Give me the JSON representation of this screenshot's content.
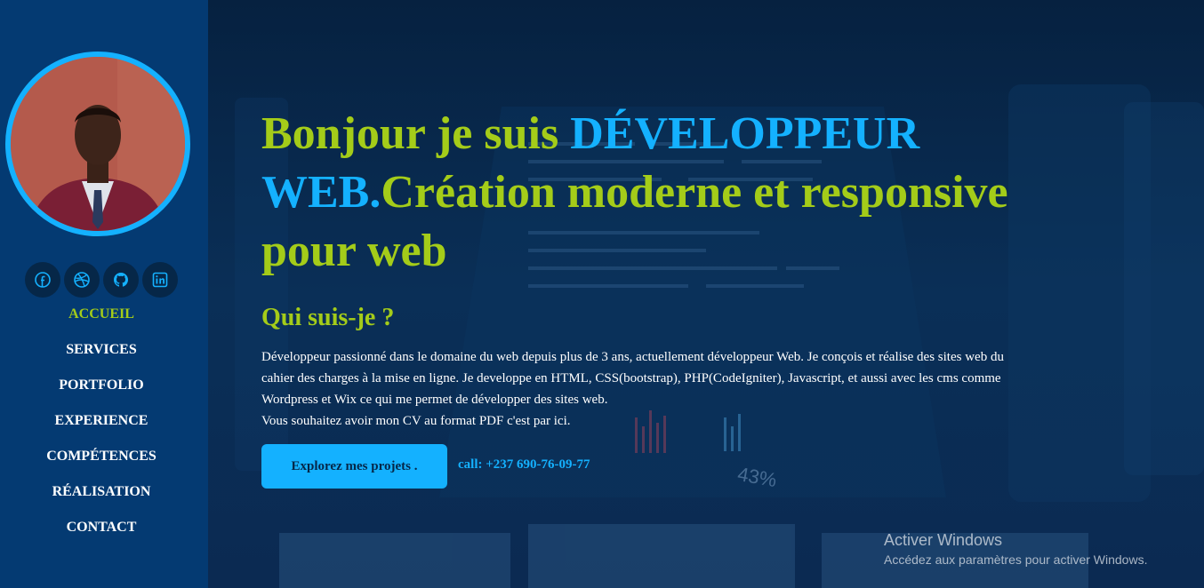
{
  "sidebar": {
    "socials": [
      {
        "icon": "facebook-icon"
      },
      {
        "icon": "dribbble-icon"
      },
      {
        "icon": "github-icon"
      },
      {
        "icon": "linkedin-icon"
      }
    ],
    "nav": [
      {
        "label": "ACCUEIL",
        "active": true
      },
      {
        "label": "SERVICES",
        "active": false
      },
      {
        "label": "PORTFOLIO",
        "active": false
      },
      {
        "label": "EXPERIENCE",
        "active": false
      },
      {
        "label": "COMPÉTENCES",
        "active": false
      },
      {
        "label": "RÉALISATION",
        "active": false
      },
      {
        "label": "CONTACT",
        "active": false
      }
    ]
  },
  "hero": {
    "title_prefix": "Bonjour je suis ",
    "title_highlight": "DÉVELOPPEUR WEB.",
    "title_suffix": "Création moderne et responsive pour web",
    "about_heading": "Qui suis-je ?",
    "about_line1": "Développeur passionné dans le domaine du web depuis plus de 3 ans, actuellement développeur Web. Je conçois et réalise des sites web du cahier des charges à la mise en ligne. Je developpe en HTML, CSS(bootstrap), PHP(CodeIgniter), Javascript, et aussi avec les cms comme Wordpress et Wix ce qui me permet de développer des sites web.",
    "about_line2": "Vous souhaitez avoir mon CV au format PDF c'est par ici.",
    "cta_label": "Explorez mes projets .",
    "call_text": "call: +237 690-76-09-77"
  },
  "background": {
    "percent_label": "43%"
  },
  "watermark": {
    "title": "Activer Windows",
    "subtitle": "Accédez aux paramètres pour activer Windows."
  },
  "colors": {
    "sidebar": "#043a72",
    "accent_green": "#a4cc19",
    "accent_blue": "#14b1ff",
    "social_bg": "#062748"
  }
}
